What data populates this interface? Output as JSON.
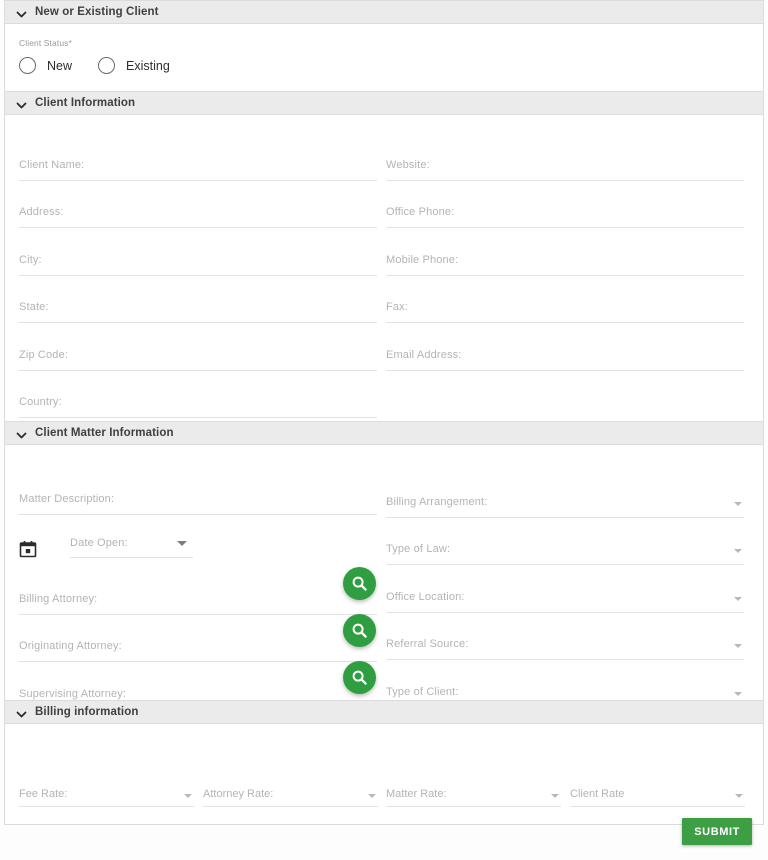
{
  "sections": {
    "client_type": {
      "title": "New or Existing Client",
      "status_label": "Client Status",
      "required_mark": "*",
      "options": [
        {
          "label": "New"
        },
        {
          "label": "Existing"
        }
      ]
    },
    "client_information": {
      "title": "Client Information",
      "left_fields": [
        {
          "label": "Client Name:",
          "value": "",
          "type": "text"
        },
        {
          "label": "Address:",
          "value": "",
          "type": "text"
        },
        {
          "label": "City:",
          "value": "",
          "type": "text"
        },
        {
          "label": "State:",
          "value": "",
          "type": "text"
        },
        {
          "label": "Zip Code:",
          "value": "",
          "type": "text"
        },
        {
          "label": "Country:",
          "value": "",
          "type": "text"
        }
      ],
      "right_fields": [
        {
          "label": "Website:",
          "value": "",
          "type": "text"
        },
        {
          "label": "Office Phone:",
          "value": "",
          "type": "text"
        },
        {
          "label": "Mobile Phone:",
          "value": "",
          "type": "text"
        },
        {
          "label": "Fax:",
          "value": "",
          "type": "text"
        },
        {
          "label": "Email Address:",
          "value": "",
          "type": "text"
        }
      ]
    },
    "client_matter": {
      "title": "Client Matter Information",
      "matter_description": {
        "label": "Matter Description:",
        "value": "",
        "type": "text"
      },
      "date_open": {
        "label": "Date Open:",
        "value": "",
        "type": "select"
      },
      "attorney_fields": [
        {
          "label": "Billing Attorney:",
          "value": "",
          "type": "lookup",
          "button": "search-button"
        },
        {
          "label": "Originating Attorney:",
          "value": "",
          "type": "lookup",
          "button": "search-button"
        },
        {
          "label": "Supervising Attorney:",
          "value": "",
          "type": "lookup",
          "button": "search-button"
        }
      ],
      "right_fields": [
        {
          "label": "Billing Arrangement:",
          "value": "",
          "type": "select"
        },
        {
          "label": "Type of Law:",
          "value": "",
          "type": "select"
        },
        {
          "label": "Office Location:",
          "value": "",
          "type": "select"
        },
        {
          "label": "Referral Source:",
          "value": "",
          "type": "select"
        },
        {
          "label": "Type of Client:",
          "value": "",
          "type": "select"
        }
      ]
    },
    "billing_information": {
      "title": "Billing information",
      "rates": [
        {
          "label": "Fee Rate:",
          "value": "",
          "type": "select"
        },
        {
          "label": "Attorney Rate:",
          "value": "",
          "type": "select"
        },
        {
          "label": "Matter Rate:",
          "value": "",
          "type": "select"
        },
        {
          "label": "Client Rate",
          "value": "",
          "type": "select"
        }
      ]
    }
  },
  "footer": {
    "submit_label": "SUBMIT"
  },
  "icons": {
    "collapse": "chevron-down-icon",
    "search": "search-icon",
    "calendar": "calendar-icon",
    "dropdown": "chevron-down-icon"
  },
  "colors": {
    "accent_green": "#3d9e43",
    "fab_green": "#2f9e41",
    "header_bg": "#ebebeb",
    "border": "#dcdcdc",
    "label_gray": "#b4b4b4",
    "title_gray": "#3f3f3f"
  }
}
